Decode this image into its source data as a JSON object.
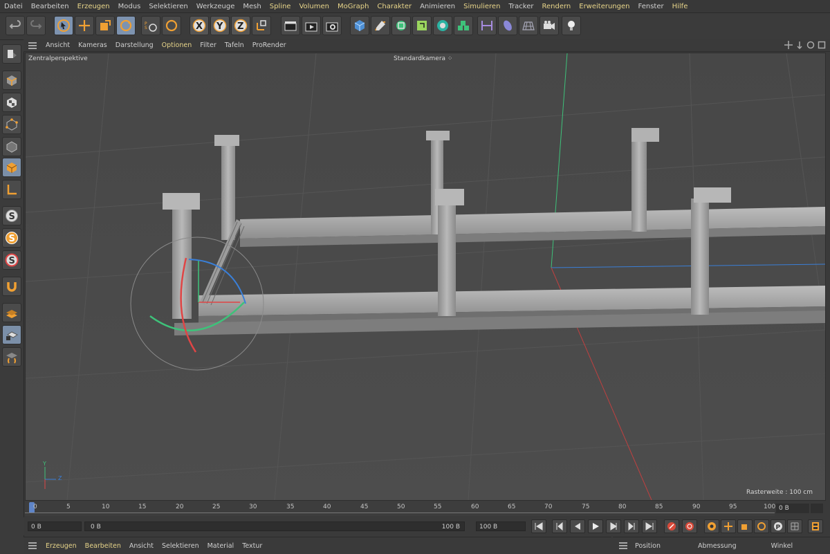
{
  "menubar": {
    "items": [
      {
        "label": "Datei"
      },
      {
        "label": "Bearbeiten"
      },
      {
        "label": "Erzeugen",
        "hl": true
      },
      {
        "label": "Modus"
      },
      {
        "label": "Selektieren"
      },
      {
        "label": "Werkzeuge"
      },
      {
        "label": "Mesh"
      },
      {
        "label": "Spline",
        "hl": true
      },
      {
        "label": "Volumen",
        "hl": true
      },
      {
        "label": "MoGraph",
        "hl": true
      },
      {
        "label": "Charakter",
        "hl": true
      },
      {
        "label": "Animieren"
      },
      {
        "label": "Simulieren",
        "hl": true
      },
      {
        "label": "Tracker"
      },
      {
        "label": "Rendern",
        "hl": true
      },
      {
        "label": "Erweiterungen",
        "hl": true
      },
      {
        "label": "Fenster"
      },
      {
        "label": "Hilfe",
        "hl": true
      }
    ]
  },
  "viewport_menu": {
    "items": [
      {
        "label": "Ansicht"
      },
      {
        "label": "Kameras"
      },
      {
        "label": "Darstellung"
      },
      {
        "label": "Optionen",
        "hl": true
      },
      {
        "label": "Filter"
      },
      {
        "label": "Tafeln"
      },
      {
        "label": "ProRender"
      }
    ]
  },
  "viewport": {
    "title": "Zentralperspektive",
    "camera": "Standardkamera",
    "grid_spacing": "Rasterweite : 100 cm",
    "axis_y": "Y",
    "axis_z": "Z"
  },
  "timeline": {
    "ticks": [
      "0",
      "5",
      "10",
      "15",
      "20",
      "25",
      "30",
      "35",
      "40",
      "45",
      "50",
      "55",
      "60",
      "65",
      "70",
      "75",
      "80",
      "85",
      "90",
      "95",
      "100"
    ],
    "current_frame": "0 B"
  },
  "transport": {
    "start_field": "0 B",
    "range_start": "0 B",
    "range_end": "100 B",
    "end_field": "100 B"
  },
  "material_bar": {
    "items": [
      {
        "label": "Erzeugen",
        "hl": true
      },
      {
        "label": "Bearbeiten",
        "hl": true
      },
      {
        "label": "Ansicht"
      },
      {
        "label": "Selektieren"
      },
      {
        "label": "Material"
      },
      {
        "label": "Textur"
      }
    ]
  },
  "attributes_bar": {
    "position": "Position",
    "size": "Abmessung",
    "rotation": "Winkel"
  },
  "colors": {
    "accent_orange": "#f0a033",
    "active_blue": "#7d93b0",
    "axis_x": "#e04545",
    "axis_y": "#3ec27a",
    "axis_z": "#3a7fd8"
  }
}
